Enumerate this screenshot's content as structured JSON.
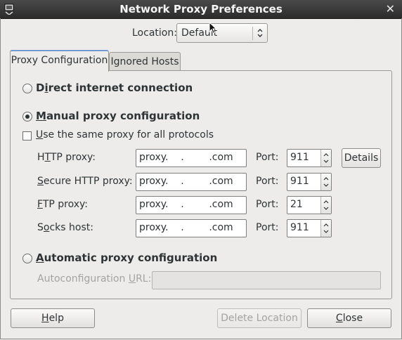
{
  "window": {
    "title": "Network Proxy Preferences"
  },
  "location": {
    "label": "Location:",
    "value": "Default"
  },
  "tabs": [
    {
      "label": "Proxy Configuration",
      "active": true
    },
    {
      "label": "Ignored Hosts",
      "active": false
    }
  ],
  "proxy_config": {
    "direct": {
      "label_first": "D",
      "label_u": "i",
      "label_rest": "rect internet connection",
      "selected": false
    },
    "manual": {
      "label_u": "M",
      "label_rest": "anual proxy configuration",
      "selected": true
    },
    "same_proxy": {
      "label_u": "U",
      "label_rest": "se the same proxy for all protocols",
      "checked": false
    },
    "rows": [
      {
        "label_pre": "H",
        "label_u": "T",
        "label_rest": "TP proxy:",
        "host": "proxy.    .        .com",
        "port_label": "Port:",
        "port": "911"
      },
      {
        "label_pre": "",
        "label_u": "S",
        "label_rest": "ecure HTTP proxy:",
        "host": "proxy.    .        .com",
        "port_label": "Port:",
        "port": "911"
      },
      {
        "label_pre": "",
        "label_u": "F",
        "label_rest": "TP proxy:",
        "host": "proxy.    .        .com",
        "port_label": "Port:",
        "port": "21"
      },
      {
        "label_pre": "S",
        "label_u": "o",
        "label_rest": "cks host:",
        "host": "proxy.    .        .com",
        "port_label": "Port:",
        "port": "911"
      }
    ],
    "details_button": "Details",
    "automatic": {
      "label_u": "A",
      "label_rest": "utomatic proxy configuration",
      "selected": false
    },
    "autoconfig": {
      "label_pre": "Autoconfiguration ",
      "label_u": "U",
      "label_rest": "RL:",
      "value": ""
    }
  },
  "footer": {
    "help_u": "H",
    "help_rest": "elp",
    "delete_location": "Delete Location",
    "close_u": "C",
    "close_rest": "lose"
  },
  "colors": {
    "titlebar": "#2b2b2b",
    "window_bg": "#edeceb",
    "tab_accent": "#6f9ad4"
  }
}
